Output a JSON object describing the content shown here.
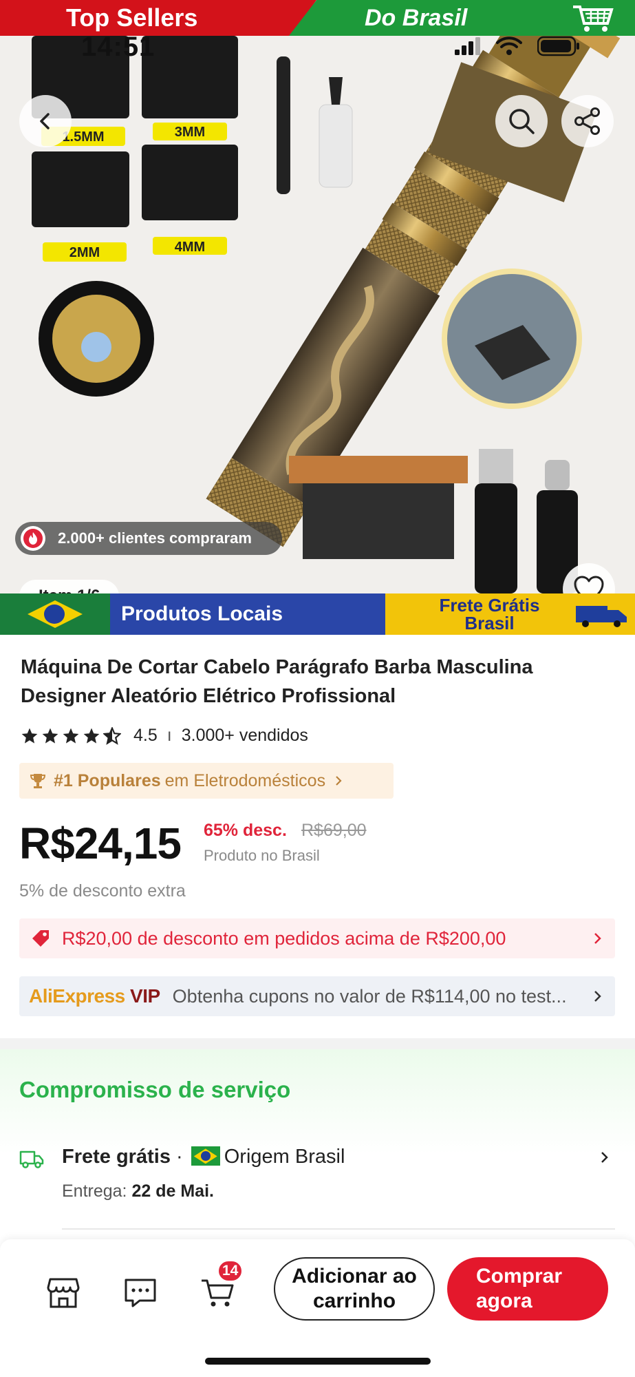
{
  "banners": {
    "top_left": "Top Sellers",
    "top_right": "Do Brasil",
    "bottom_left": "Produtos Locais",
    "bottom_right": "Frete Grátis Brasil"
  },
  "status_bar": {
    "time": "14:51"
  },
  "product_art": {
    "comb_labels": [
      "1.5MM",
      "3MM",
      "2MM",
      "4MM"
    ]
  },
  "gallery": {
    "buyers_text": "2.000+ clientes compraram",
    "item_counter": "Item 1/6"
  },
  "product": {
    "title": "Máquina De Cortar Cabelo Parágrafo Barba Masculina Designer Aleatório Elétrico Profissional",
    "rating": "4.5",
    "rating_stars": 4.5,
    "sold": "3.000+ vendidos",
    "popular_rank": "#1 Populares",
    "popular_category": "em Eletrodomésticos",
    "price": "R$24,15",
    "discount": "65% desc.",
    "old_price": "R$69,00",
    "origin_note": "Produto no Brasil",
    "extra_discount": "5% de desconto extra"
  },
  "coupon": {
    "text": "R$20,00 de desconto em pedidos acima de R$200,00"
  },
  "vip": {
    "logo_main": "AliExpress",
    "logo_suffix": "VIP",
    "text": "Obtenha cupons no valor de R$114,00 no test..."
  },
  "service": {
    "title": "Compromisso de serviço",
    "shipping_label": "Frete grátis",
    "separator": "·",
    "origin": "Origem Brasil",
    "delivery_label": "Entrega:",
    "delivery_date": "22 de Mai."
  },
  "bottom_bar": {
    "cart_count": "14",
    "add_to_cart": "Adicionar ao carrinho",
    "buy_now": "Comprar agora"
  },
  "colors": {
    "accent_red": "#e4182c",
    "service_green": "#2bb24c",
    "popular_gold": "#b9813a"
  }
}
